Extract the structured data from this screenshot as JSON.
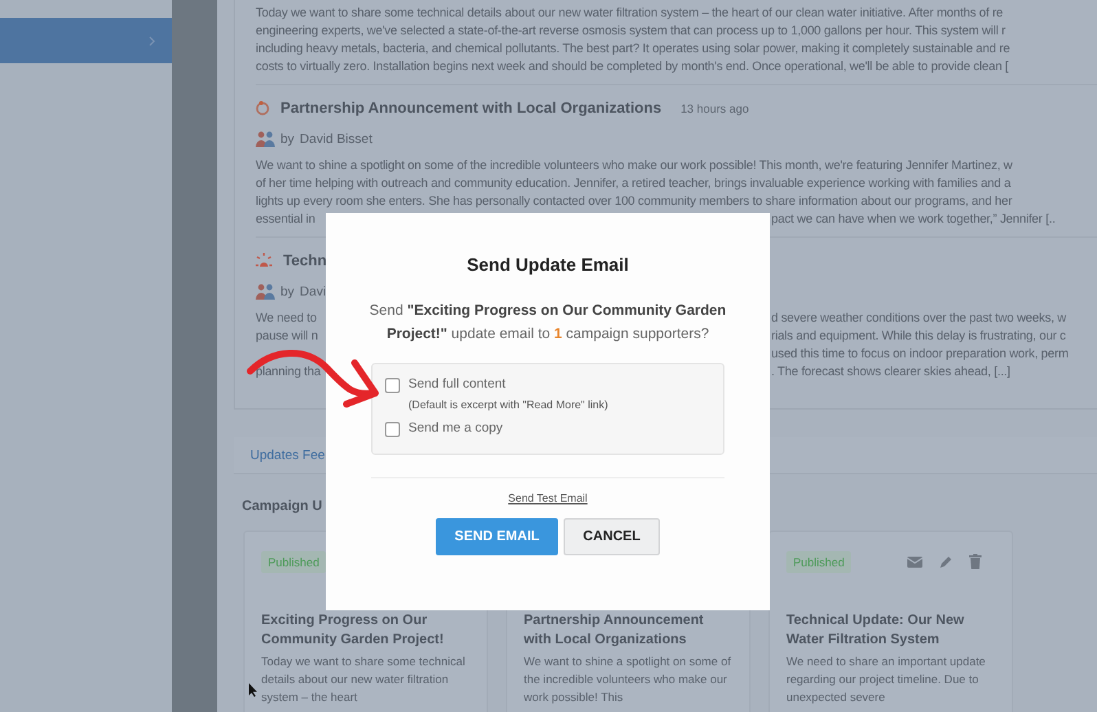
{
  "sidebar": {
    "items": [
      {
        "selected": true
      }
    ]
  },
  "posts": [
    {
      "lines": [
        {
          "text": "Today we want to share some technical details about our new water filtration system – the heart of our clean water initiative. After months of re"
        },
        {
          "text": "engineering experts, we've selected a state-of-the-art reverse osmosis system that can process up to 1,000 gallons per hour. This system will r"
        },
        {
          "text": "including heavy metals, bacteria, and chemical pollutants. The best part? It operates using solar power, making it completely sustainable and re"
        },
        {
          "text": "costs to virtually zero. Installation begins next week and should be completed by month's end. Once operational, we'll be able to provide clean ["
        }
      ]
    },
    {
      "title": "Partnership Announcement with Local Organizations",
      "time": "13 hours ago",
      "by": "by",
      "author": "David Bisset",
      "lines": [
        {
          "text": "We want to shine a spotlight on some of the incredible volunteers who make our work possible! This month, we're featuring Jennifer Martinez, w"
        },
        {
          "text": "of her time helping with outreach and community education. Jennifer, a retired teacher, brings invaluable experience working with families and a"
        },
        {
          "text": "lights up every room she enters. She has personally contacted over 100 community members to share information about our programs, and her"
        },
        {
          "left": "essential in",
          "right": "pact we can have when we work together,” Jennifer [.."
        }
      ]
    },
    {
      "title": "Techn",
      "by": "by",
      "author": "Davi",
      "lines": [
        {
          "left": "We need to",
          "right": "d severe weather conditions over the past two weeks, w"
        },
        {
          "left": "pause will n",
          "right": "rials and equipment. While this delay is frustrating, our c"
        },
        {
          "right": "used this time to focus on indoor preparation work, perm"
        },
        {
          "left": "planning tha",
          "right": ". The forecast shows clearer skies ahead, [...]"
        }
      ]
    }
  ],
  "tabs": [
    {
      "label": "Updates Fee",
      "selected": true
    }
  ],
  "section_title": "Campaign U",
  "cards": [
    {
      "status": "Published",
      "title": "Exciting Progress on Our Community Garden Project!",
      "excerpt": "Today we want to share some technical details about our new water filtration system – the heart"
    },
    {
      "title": "Partnership Announcement with Local Organizations",
      "excerpt": "We want to shine a spotlight on some of the incredible volunteers who make our work possible! This"
    },
    {
      "status": "Published",
      "actions": true,
      "title": "Technical Update: Our New Water Filtration System",
      "excerpt": "We need to share an important update regarding our project timeline. Due to unexpected severe"
    }
  ],
  "modal": {
    "title": "Send Update Email",
    "message": {
      "prefix": "Send",
      "subject": "\"Exciting Progress on Our Community Garden Project!\"",
      "middle": "update email to",
      "count": "1",
      "suffix": "campaign supporters?"
    },
    "options": [
      {
        "label": "Send full content",
        "hint": "(Default is excerpt with \"Read More\" link)",
        "checked": false
      },
      {
        "label": "Send me a copy",
        "checked": false
      }
    ],
    "test_link": "Send Test Email",
    "buttons": [
      {
        "label": "SEND EMAIL",
        "kind": "primary"
      },
      {
        "label": "CANCEL",
        "kind": "secondary"
      }
    ]
  }
}
